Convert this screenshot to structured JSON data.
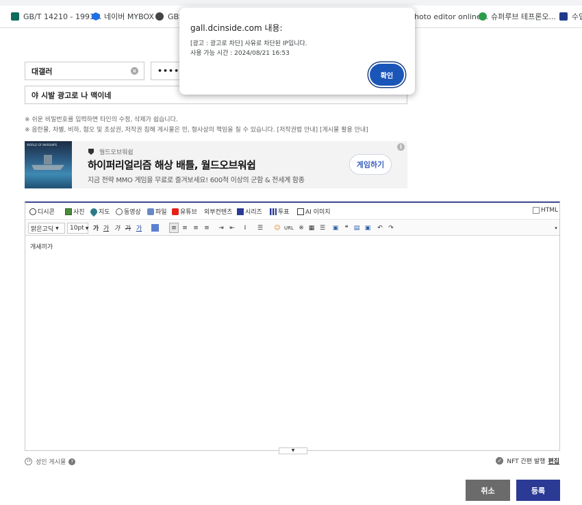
{
  "bookmarks": [
    {
      "label": "GB/T 14210 - 1993...",
      "icon": "gbt-logo-icon",
      "color": "#0f6b5c"
    },
    {
      "label": "네이버 MYBOX",
      "icon": "cube-icon",
      "color": "#1f6fe5"
    },
    {
      "label": "GBS",
      "icon": "globe-icon",
      "color": "#444444"
    },
    {
      "label": "hoto editor online...",
      "icon": "photo-editor-icon",
      "color": "#2a7be4"
    },
    {
      "label": "슈퍼루브 테프론오...",
      "icon": "leaf-logo-icon",
      "color": "#2a9d4a"
    },
    {
      "label": "수입",
      "icon": "k-logo-icon",
      "color": "#203a8a"
    }
  ],
  "form": {
    "nickname": "대갤러",
    "password_mask": "••••",
    "title": "야 시발 광고로 나 맥이네",
    "notice_1": "※ 쉬운 비밀번호를 입력하면 타인의 수정, 삭제가 쉽습니다.",
    "notice_2": "※ 음란물, 차별, 비하, 혐오 및 초상권, 저작권 침해 게시물은 민, 형사상의 책임을 질 수 있습니다. [저작권법 안내] [게시물 활용 안내]"
  },
  "ad": {
    "brand": "월드오브워쉽",
    "title": "하이퍼리얼리즘 해상 배틀, 월드오브워쉽",
    "desc": "지금 전략 MMO 게임을 무료로 즐겨보세요! 600척 이상의 군함 & 전세계 함종",
    "button": "게임하기",
    "img_tag": "WORLD OF WARSHIPS"
  },
  "toolbar1": {
    "items": [
      "디시콘",
      "사진",
      "지도",
      "동영상",
      "파일",
      "유튜브",
      "외부컨텐츠",
      "시리즈",
      "투표",
      "AI 이미지"
    ],
    "html_label": "HTML"
  },
  "toolbar2": {
    "font": "맑은고딕",
    "size": "10pt",
    "url_label": "URL",
    "buttons": [
      "가",
      "가",
      "가",
      "가",
      "가"
    ]
  },
  "editor": {
    "content": "개새끼가"
  },
  "bottom": {
    "adult_label": "성인 게시물",
    "adult_badge": "19",
    "nft_label": "NFT 간편 발행",
    "nft_edit": "편집",
    "cancel": "취소",
    "submit": "등록"
  },
  "dialog": {
    "title": "gall.dcinside.com 내용:",
    "msg1": "[광고 : 광고로 차단] 사유로 차단된 IP입니다.",
    "msg2": "사용 가능 시간 : 2024/08/21 16:53",
    "ok": "확인"
  }
}
